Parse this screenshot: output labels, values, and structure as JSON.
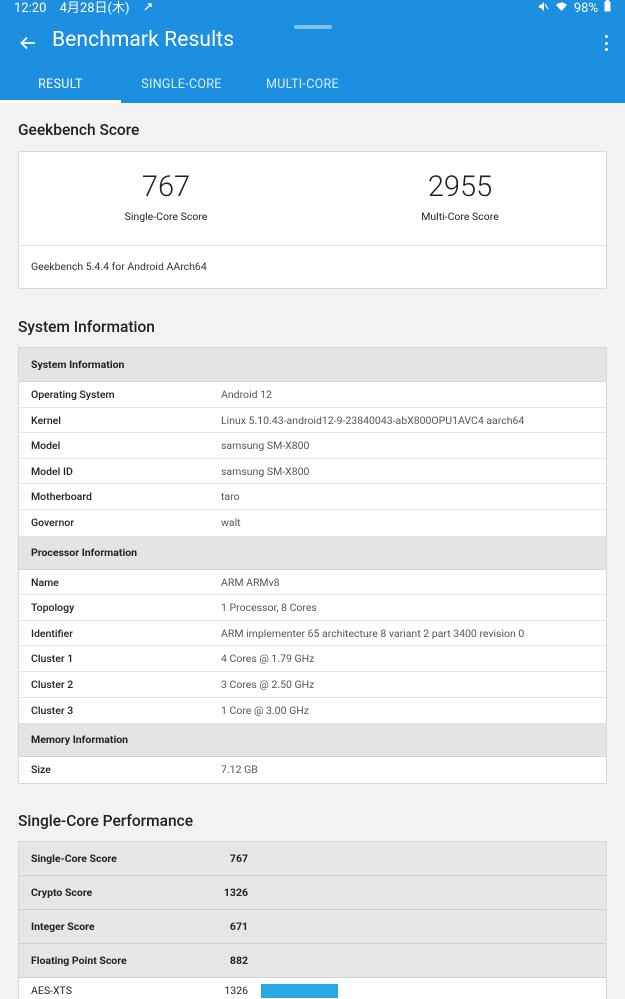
{
  "status": {
    "time": "12:20",
    "date": "4月28日(木)",
    "battery": "98%"
  },
  "appbar": {
    "title": "Benchmark Results"
  },
  "tabs": [
    {
      "label": "RESULT",
      "active": true
    },
    {
      "label": "SINGLE-CORE",
      "active": false
    },
    {
      "label": "MULTI-CORE",
      "active": false
    }
  ],
  "geekbench": {
    "title": "Geekbench Score",
    "single_value": "767",
    "single_label": "Single-Core Score",
    "multi_value": "2955",
    "multi_label": "Multi-Core Score",
    "version": "Geekbench 5.4.4 for Android AArch64"
  },
  "sysinfo": {
    "title": "System Information",
    "group_system": "System Information",
    "system": [
      {
        "key": "Operating System",
        "value": "Android 12"
      },
      {
        "key": "Kernel",
        "value": "Linux 5.10.43-android12-9-23840043-abX800OPU1AVC4 aarch64"
      },
      {
        "key": "Model",
        "value": "samsung SM-X800"
      },
      {
        "key": "Model ID",
        "value": "samsung SM-X800"
      },
      {
        "key": "Motherboard",
        "value": "taro"
      },
      {
        "key": "Governor",
        "value": "walt"
      }
    ],
    "group_processor": "Processor Information",
    "processor": [
      {
        "key": "Name",
        "value": "ARM ARMv8"
      },
      {
        "key": "Topology",
        "value": "1 Processor, 8 Cores"
      },
      {
        "key": "Identifier",
        "value": "ARM implementer 65 architecture 8 variant 2 part 3400 revision 0"
      },
      {
        "key": "Cluster 1",
        "value": "4 Cores @ 1.79 GHz"
      },
      {
        "key": "Cluster 2",
        "value": "3 Cores @ 2.50 GHz"
      },
      {
        "key": "Cluster 3",
        "value": "1 Core @ 3.00 GHz"
      }
    ],
    "group_memory": "Memory Information",
    "memory": [
      {
        "key": "Size",
        "value": "7.12 GB"
      }
    ]
  },
  "single_perf": {
    "title": "Single-Core Performance",
    "rows": [
      {
        "key": "Single-Core Score",
        "value": "767"
      },
      {
        "key": "Crypto Score",
        "value": "1326"
      },
      {
        "key": "Integer Score",
        "value": "671"
      },
      {
        "key": "Floating Point Score",
        "value": "882"
      }
    ],
    "sub": [
      {
        "key": "AES-XTS",
        "value": "1326",
        "bar_fraction": 0.137
      }
    ]
  }
}
